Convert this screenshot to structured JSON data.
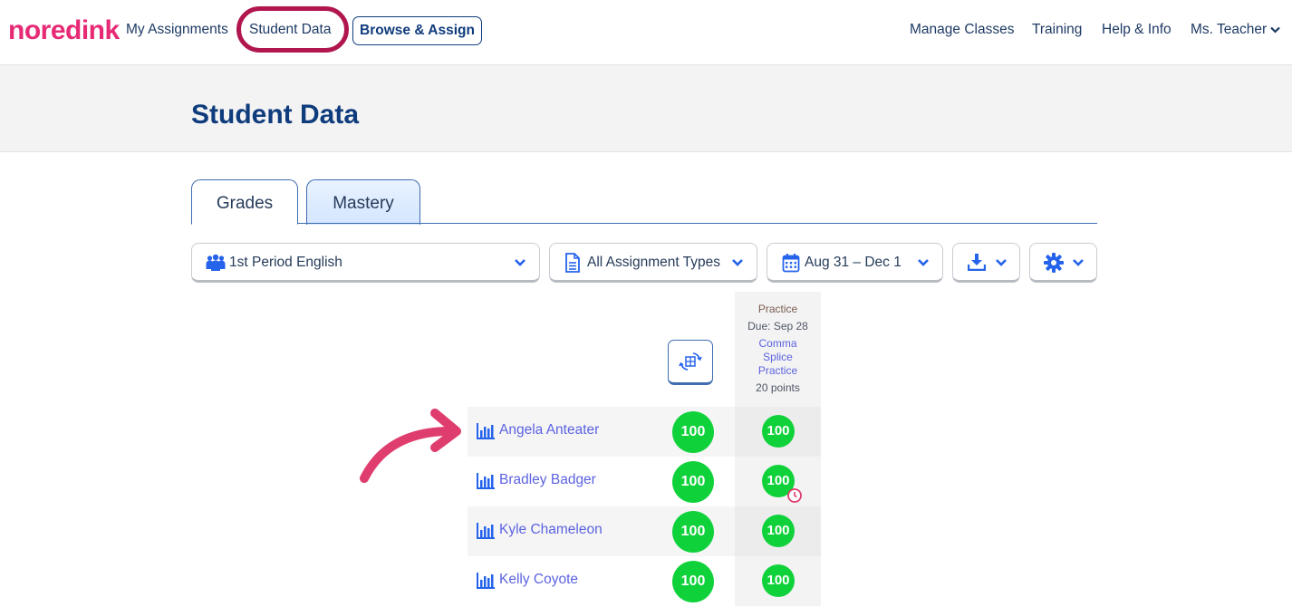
{
  "nav": {
    "logo": {
      "no": "no",
      "red": "red",
      "ink": "ink"
    },
    "links": [
      "My Assignments",
      "Student Data"
    ],
    "browse_label": "Browse & Assign",
    "right": [
      "Manage Classes",
      "Training",
      "Help & Info",
      "Ms. Teacher"
    ]
  },
  "page": {
    "title": "Student Data"
  },
  "tabs": [
    "Grades",
    "Mastery"
  ],
  "filters": {
    "class": "1st Period English",
    "types": "All Assignment Types",
    "dates": "Aug 31 – Dec 1"
  },
  "assignment": {
    "type": "Practice",
    "due": "Due: Sep 28",
    "name": "Comma Splice Practice",
    "points": "20 points"
  },
  "students": [
    {
      "name": "Angela Anteater",
      "total": "100",
      "score": "100",
      "late": false
    },
    {
      "name": "Bradley Badger",
      "total": "100",
      "score": "100",
      "late": true
    },
    {
      "name": "Kyle Chameleon",
      "total": "100",
      "score": "100",
      "late": false
    },
    {
      "name": "Kelly Coyote",
      "total": "100",
      "score": "100",
      "late": false
    }
  ],
  "colors": {
    "brand": "#e72a75",
    "navy": "#0f3c7d",
    "link": "#5c63e0",
    "score": "#0fd23b",
    "highlight": "#b1174e"
  }
}
